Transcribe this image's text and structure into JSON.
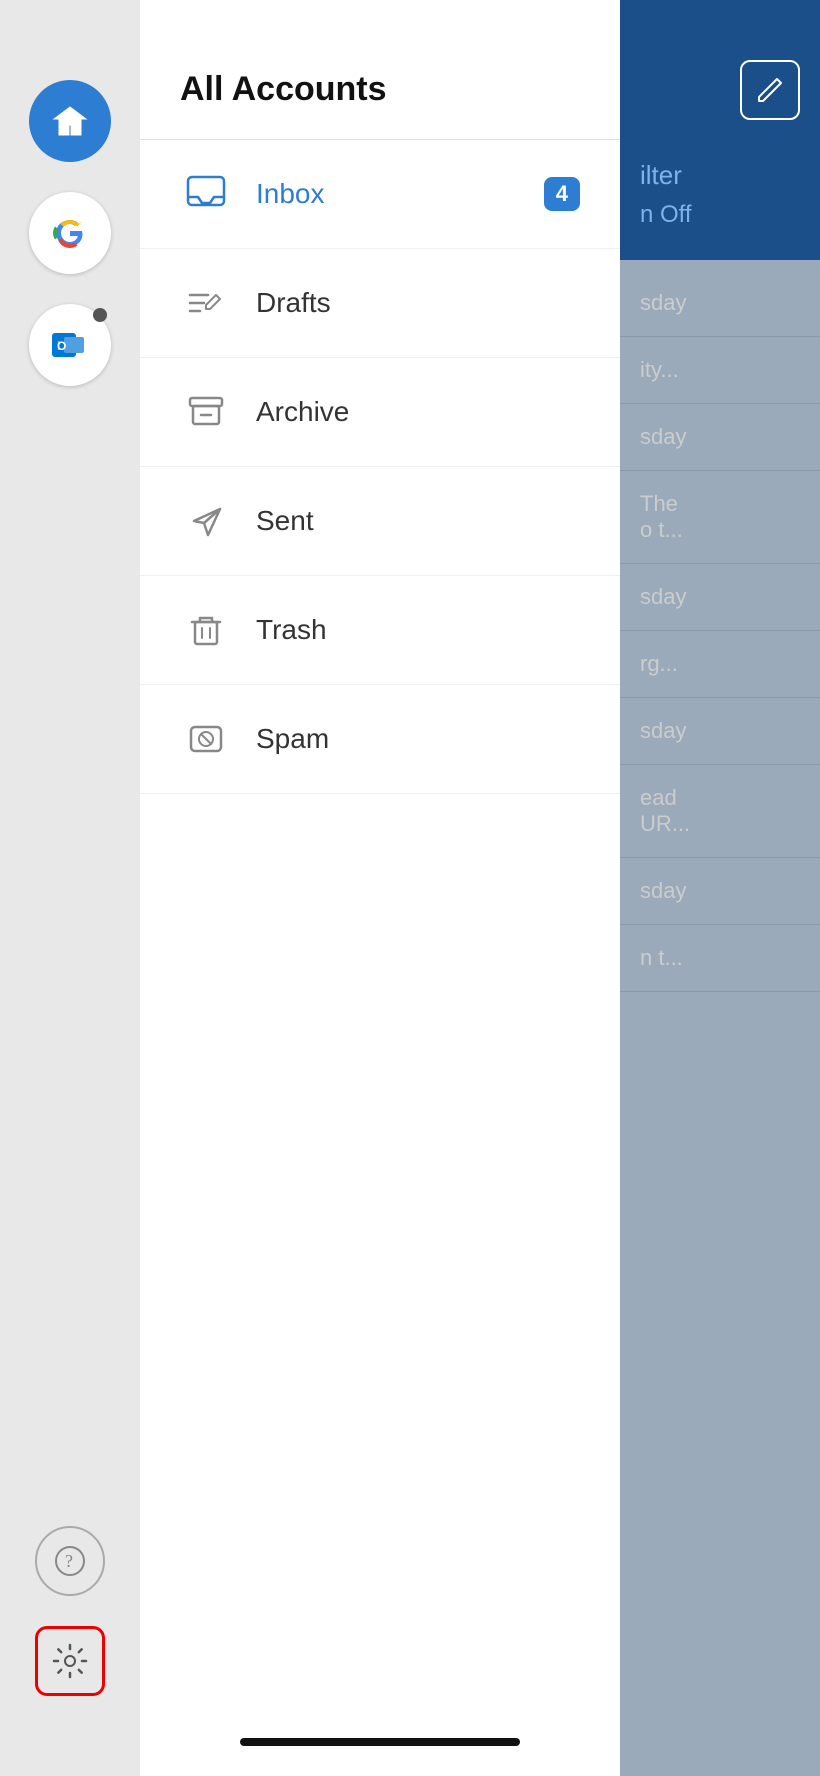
{
  "sidebar": {
    "accounts": [
      {
        "id": "home",
        "type": "home",
        "active": true,
        "label": "Home Account"
      },
      {
        "id": "google",
        "type": "google",
        "active": false,
        "label": "Google Account"
      },
      {
        "id": "outlook",
        "type": "outlook",
        "active": false,
        "label": "Outlook Account",
        "hasNotification": true
      }
    ],
    "help_label": "Help",
    "settings_label": "Settings"
  },
  "drawer": {
    "title": "All Accounts",
    "menu_items": [
      {
        "id": "inbox",
        "label": "Inbox",
        "active": true,
        "badge": "4"
      },
      {
        "id": "drafts",
        "label": "Drafts",
        "active": false,
        "badge": null
      },
      {
        "id": "archive",
        "label": "Archive",
        "active": false,
        "badge": null
      },
      {
        "id": "sent",
        "label": "Sent",
        "active": false,
        "badge": null
      },
      {
        "id": "trash",
        "label": "Trash",
        "active": false,
        "badge": null
      },
      {
        "id": "spam",
        "label": "Spam",
        "active": false,
        "badge": null
      }
    ]
  },
  "right_panel": {
    "filter_text": "Filter",
    "focus_off_text": "n Off",
    "list_items": [
      "sday",
      "ity...",
      "sday",
      "The\no t...",
      "sday",
      "rg...",
      "sday",
      "ead\nUR...",
      "sday",
      "n t..."
    ]
  }
}
